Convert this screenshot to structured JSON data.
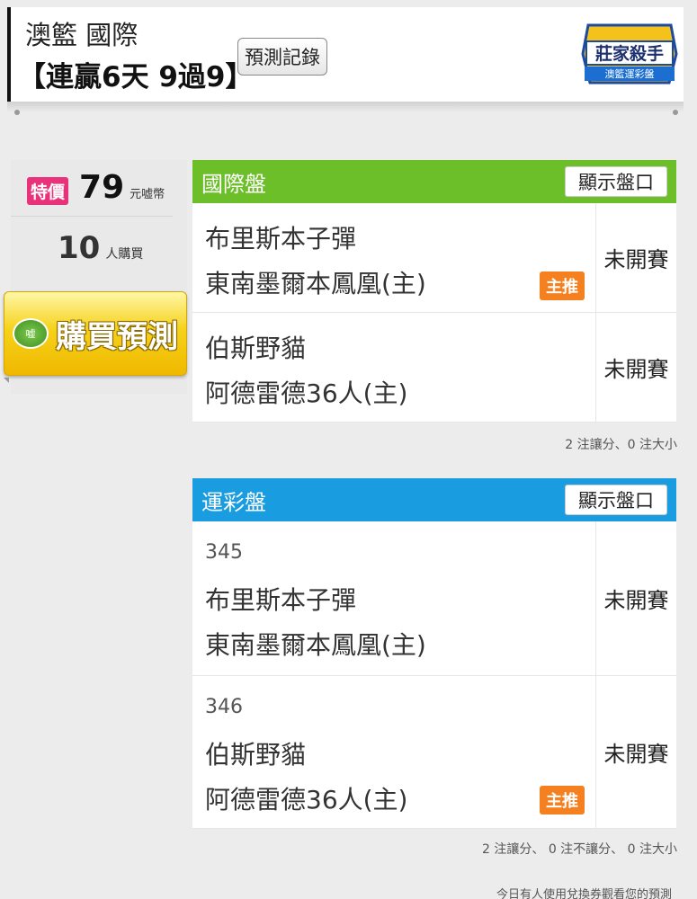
{
  "header": {
    "title": "澳籃 國際",
    "streak": "【連贏6天 9過9】",
    "record_button": "預測記錄",
    "logo_text_top": "莊家殺手",
    "logo_text_bottom": "澳籃運彩盤"
  },
  "sidebar": {
    "tag": "特價",
    "price": "79",
    "currency": "元嘘幣",
    "buyers": "10",
    "buyers_unit": "人購買",
    "buy_badge": "嘘",
    "buy_label": "購買預測"
  },
  "intl_panel": {
    "name": "國際盤",
    "show_button": "顯示盤口",
    "color": "#6dbf2a",
    "games": [
      {
        "away": "布里斯本子彈",
        "home": "東南墨爾本鳳凰(主)",
        "status": "未開賽",
        "badge": "主推"
      },
      {
        "away": "伯斯野貓",
        "home": "阿德雷德36人(主)",
        "status": "未開賽",
        "badge": ""
      }
    ],
    "note": "2 注讓分、0 注大小"
  },
  "sport_panel": {
    "name": "運彩盤",
    "show_button": "顯示盤口",
    "color": "#1a9de0",
    "games": [
      {
        "code": "345",
        "away": "布里斯本子彈",
        "home": "東南墨爾本鳳凰(主)",
        "status": "未開賽",
        "badge": ""
      },
      {
        "code": "346",
        "away": "伯斯野貓",
        "home": "阿德雷德36人(主)",
        "status": "未開賽",
        "badge": "主推"
      }
    ],
    "note": "2 注讓分、 0 注不讓分、 0 注大小"
  },
  "footer_note": "今日有人使用兌換券觀看您的預測"
}
